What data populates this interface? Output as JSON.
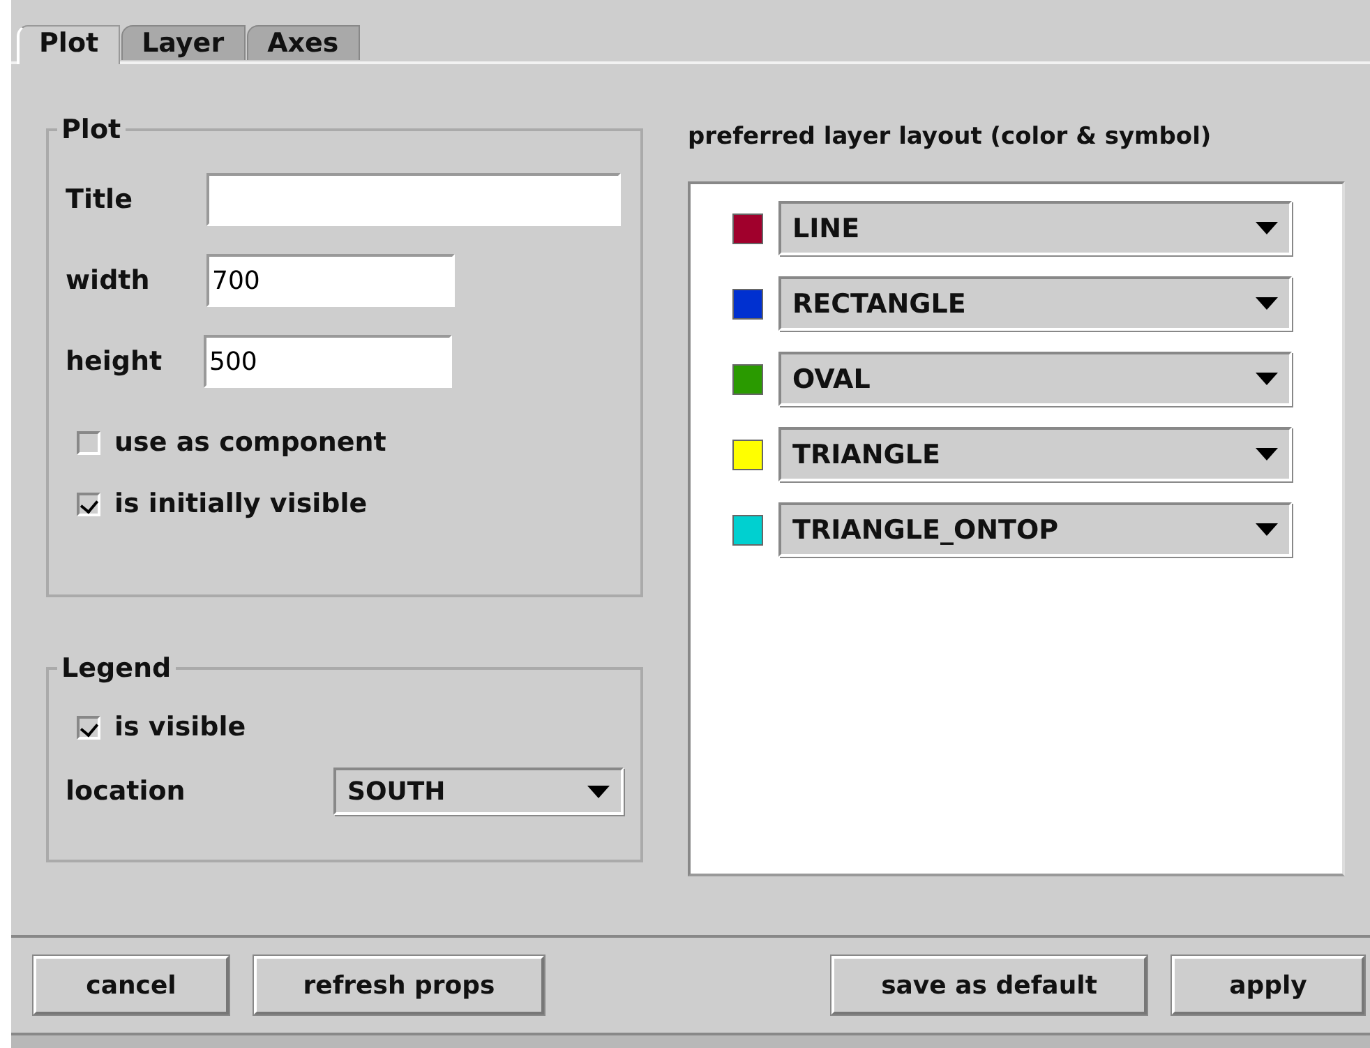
{
  "tabs": [
    {
      "label": "Plot",
      "selected": true
    },
    {
      "label": "Layer",
      "selected": false
    },
    {
      "label": "Axes",
      "selected": false
    }
  ],
  "plot_group": {
    "legend": "Plot",
    "fields": [
      {
        "label": "Title"
      },
      {
        "label": "width",
        "value": "700"
      },
      {
        "label": "height",
        "value": "500"
      }
    ],
    "checkboxes": [
      {
        "label": "use as component",
        "checked": false
      },
      {
        "label": "is initially visible",
        "checked": true
      }
    ]
  },
  "legend_group": {
    "legend": "Legend",
    "checkboxes": [
      {
        "label": "is visible",
        "checked": true
      }
    ],
    "location": {
      "label": "location",
      "value": "SOUTH"
    }
  },
  "layer_layout": {
    "title": "preferred layer layout (color & symbol)",
    "layers": [
      {
        "color": "#a0002c",
        "symbol": "LINE"
      },
      {
        "color": "#0030d0",
        "symbol": "RECTANGLE"
      },
      {
        "color": "#2a9a00",
        "symbol": "OVAL"
      },
      {
        "color": "#ffff00",
        "symbol": "TRIANGLE"
      },
      {
        "color": "#00d0d0",
        "symbol": "TRIANGLE_ONTOP"
      }
    ]
  },
  "buttons_left": [
    "cancel",
    "refresh props"
  ],
  "buttons_right": [
    "save as default",
    "apply"
  ]
}
